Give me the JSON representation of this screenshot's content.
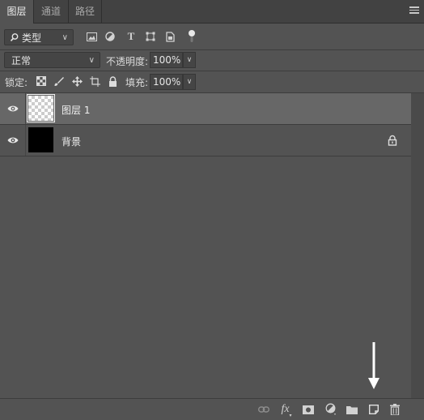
{
  "tabs": [
    "图层",
    "通道",
    "路径"
  ],
  "filter": {
    "kind_label": "类型",
    "kind_icons": [
      "image-filter-icon",
      "adjustment-filter-icon",
      "type-filter-icon",
      "shape-filter-icon",
      "smart-object-filter-icon",
      "filter-toggle-icon"
    ]
  },
  "blend": {
    "mode": "正常",
    "opacity_label": "不透明度:",
    "opacity_value": "100%"
  },
  "lock": {
    "label": "锁定:",
    "fill_label": "填充:",
    "fill_value": "100%"
  },
  "layers": [
    {
      "name": "图层 1",
      "visible": true,
      "selected": true,
      "thumbnail": "transparent"
    },
    {
      "name": "背景",
      "visible": true,
      "selected": false,
      "thumbnail": "black",
      "locked": true
    }
  ],
  "bottom_icons": [
    "link-layers-icon",
    "layer-style-fx-icon",
    "add-mask-icon",
    "new-adjustment-layer-icon",
    "new-group-folder-icon",
    "new-layer-icon",
    "delete-layer-icon"
  ],
  "bottom_fx_label": "fx",
  "annotation": "arrow-pointing-to-new-layer-icon"
}
